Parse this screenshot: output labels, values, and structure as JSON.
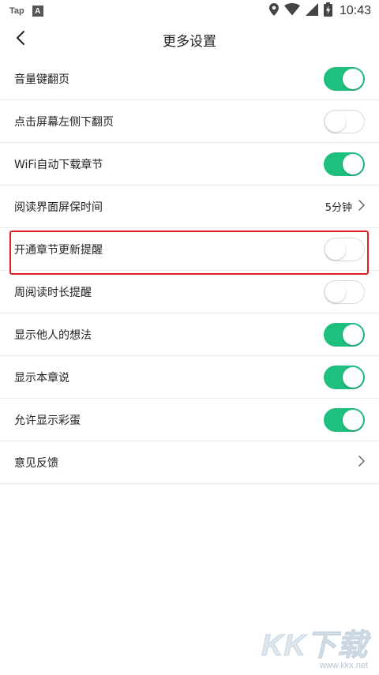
{
  "status_bar": {
    "app_name": "Tap",
    "app_icon_letter": "A",
    "time": "10:43",
    "battery_icon": "battery-charging-icon",
    "wifi_icon": "wifi-icon",
    "location_icon": "location-icon",
    "signal_icon": "signal-icon"
  },
  "header": {
    "title": "更多设置",
    "back_icon": "chevron-left-icon"
  },
  "settings": [
    {
      "label": "音量键翻页",
      "type": "toggle",
      "on": true
    },
    {
      "label": "点击屏幕左侧下翻页",
      "type": "toggle",
      "on": false
    },
    {
      "label": "WiFi自动下载章节",
      "type": "toggle",
      "on": true
    },
    {
      "label": "阅读界面屏保时间",
      "type": "value",
      "value": "5分钟"
    },
    {
      "label": "开通章节更新提醒",
      "type": "toggle",
      "on": false
    },
    {
      "label": "周阅读时长提醒",
      "type": "toggle",
      "on": false
    },
    {
      "label": "显示他人的想法",
      "type": "toggle",
      "on": true
    },
    {
      "label": "显示本章说",
      "type": "toggle",
      "on": true
    },
    {
      "label": "允许显示彩蛋",
      "type": "toggle",
      "on": true
    },
    {
      "label": "意见反馈",
      "type": "link"
    }
  ],
  "colors": {
    "toggle_on": "#1fbf7f",
    "highlight_border": "#e11d1d"
  },
  "watermark": {
    "logo": "KK下载",
    "url": "www.kkx.net"
  }
}
